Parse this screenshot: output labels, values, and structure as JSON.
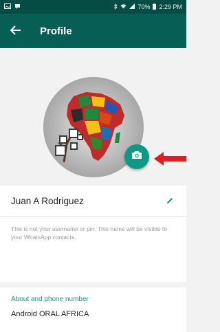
{
  "status_bar": {
    "left_icons": [
      "image-icon",
      "chat-icon"
    ],
    "right_text": "70%",
    "time": "2:29 PM"
  },
  "app_bar": {
    "title": "Profile",
    "back_icon": "back-arrow-icon",
    "color": "#075e54"
  },
  "profile": {
    "name": "Juan A Rodriguez",
    "helper": "This is not your username or pin. This name will be visible to your WhatsApp contacts.",
    "camera_icon": "camera-icon",
    "edit_icon": "pencil-icon"
  },
  "about": {
    "label": "About and phone number",
    "value": "Android ORAL AFRICA"
  },
  "colors": {
    "accent": "#0c9a85",
    "arrow": "#e01e1e"
  }
}
